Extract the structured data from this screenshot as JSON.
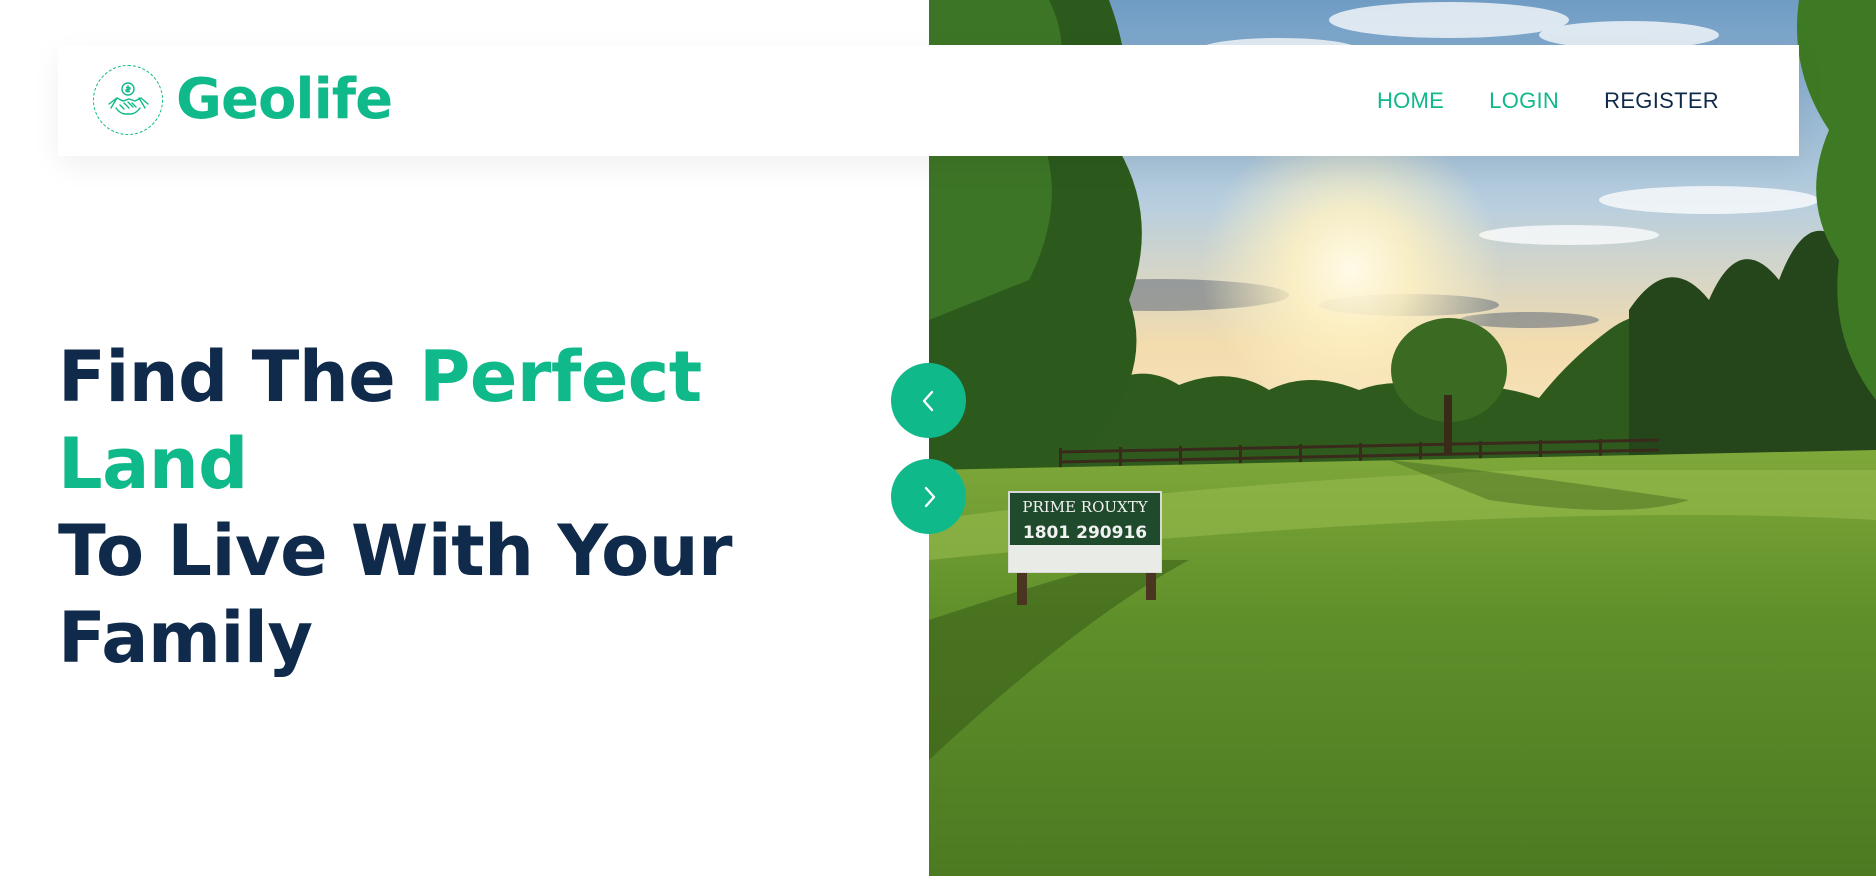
{
  "brand": {
    "name": "Geolife",
    "logo_icon": "handshake-coin-icon",
    "color": "#10b98a"
  },
  "nav": {
    "items": [
      {
        "label": "HOME",
        "active": true
      },
      {
        "label": "LOGIN",
        "active": true
      },
      {
        "label": "REGISTER",
        "active": false
      }
    ]
  },
  "hero": {
    "headline_part1": "Find The ",
    "headline_accent": "Perfect Land",
    "headline_part2": "To Live With Your Family",
    "text_color": "#0f2a4a",
    "accent_color": "#10b98a",
    "image_sign_line1": "PRIME ROUXTY",
    "image_sign_line2": "1801 290916"
  },
  "slider": {
    "prev_icon": "chevron-left-icon",
    "next_icon": "chevron-right-icon"
  }
}
